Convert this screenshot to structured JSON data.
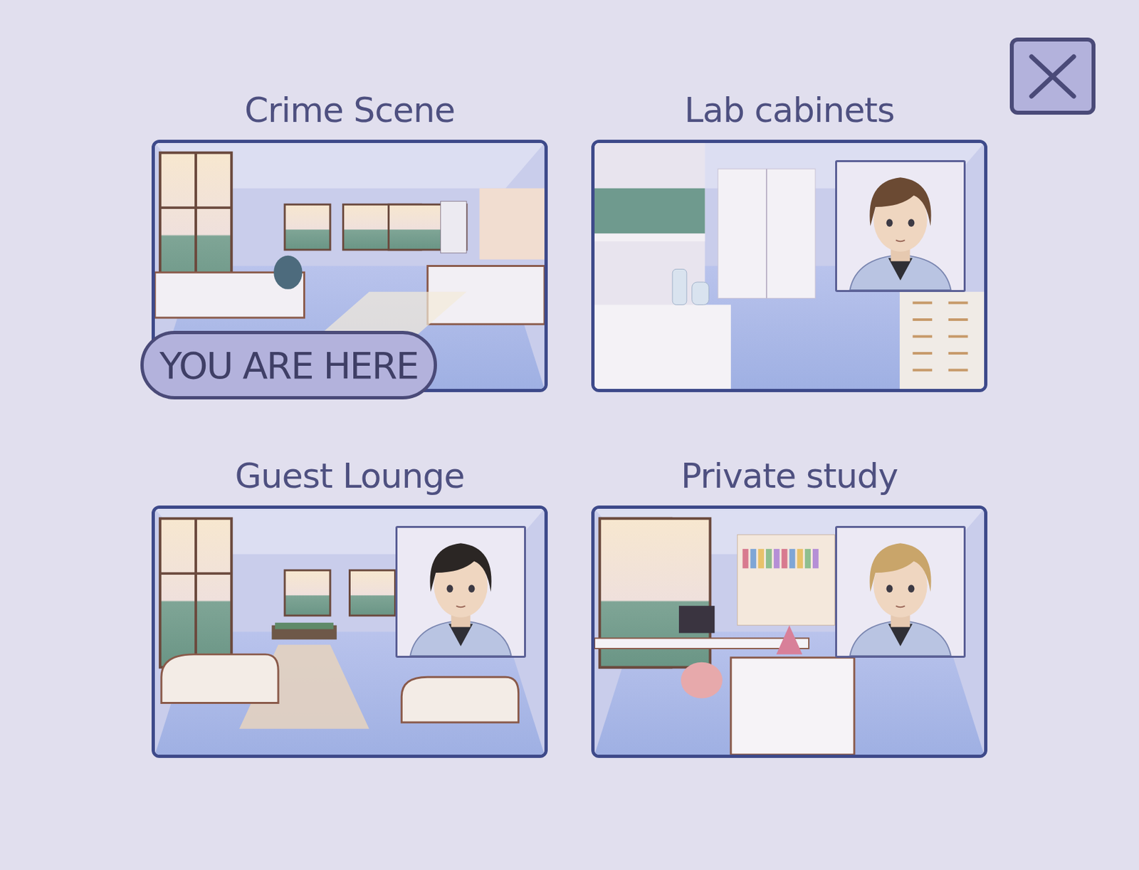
{
  "locations": [
    {
      "name": "Crime Scene",
      "current": true,
      "portrait": false
    },
    {
      "name": "Lab cabinets",
      "current": false,
      "portrait": true,
      "color": "#6b4a33"
    },
    {
      "name": "Guest Lounge",
      "current": false,
      "portrait": true,
      "color": "#2b2624"
    },
    {
      "name": "Private study",
      "current": false,
      "portrait": true,
      "color": "#c9a56a"
    }
  ],
  "badge": "YOU ARE HERE"
}
